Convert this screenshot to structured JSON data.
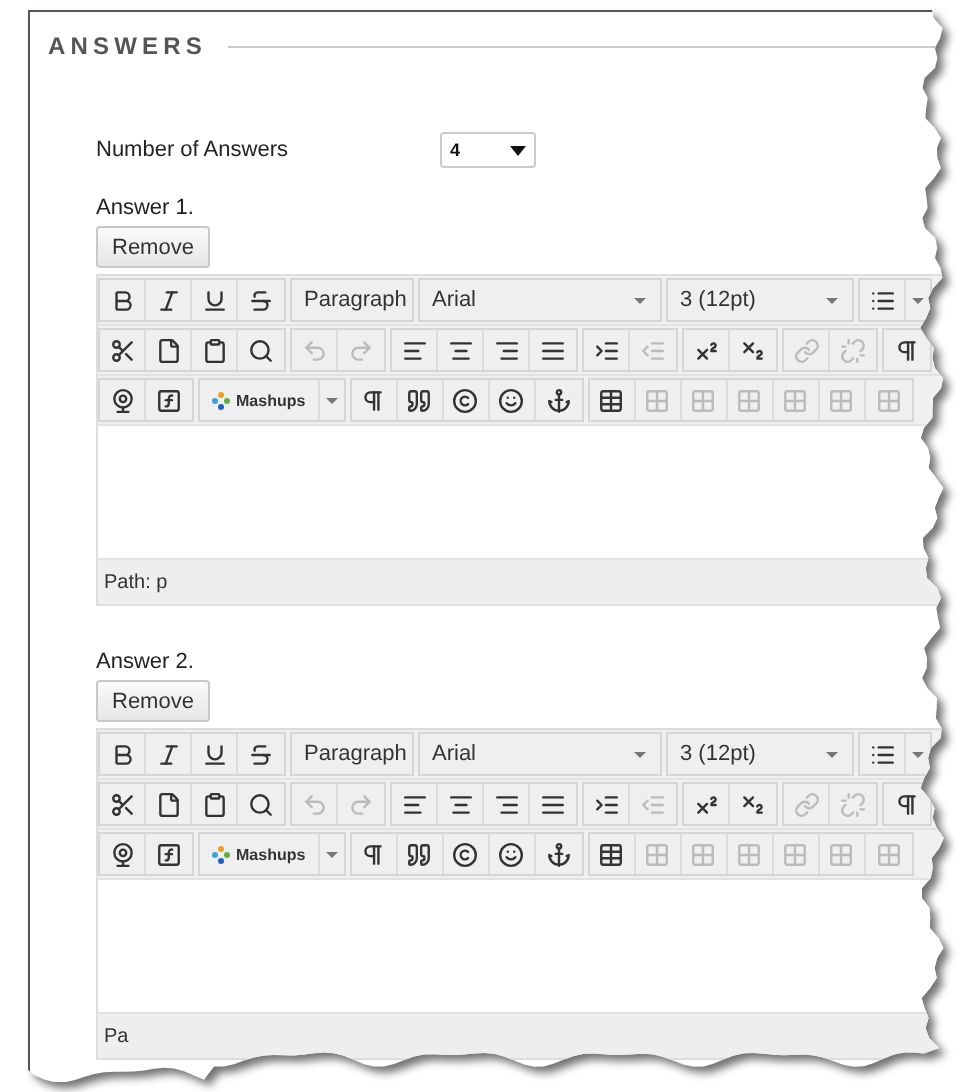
{
  "section": {
    "title": "ANSWERS"
  },
  "number_of_answers": {
    "label": "Number of Answers",
    "value": "4"
  },
  "answers": [
    {
      "label": "Answer 1.",
      "remove_button": "Remove",
      "editor": {
        "dropdowns": [
          "Paragraph",
          "Arial",
          "3 (12pt)"
        ],
        "mashups": "Mashups",
        "path": "Path: p",
        "buttons": [
          {
            "disabled": false
          },
          {
            "disabled": false
          },
          {
            "disabled": false
          },
          {
            "disabled": false
          },
          {
            "disabled": false
          },
          {
            "disabled": false
          },
          {
            "disabled": false
          },
          {
            "disabled": false
          },
          {
            "disabled": false
          },
          {
            "disabled": true
          },
          {
            "disabled": true
          },
          {
            "disabled": false
          },
          {
            "disabled": false
          },
          {
            "disabled": false
          },
          {
            "disabled": false
          },
          {
            "disabled": false
          },
          {
            "disabled": true
          },
          {
            "disabled": false
          },
          {
            "disabled": false
          },
          {
            "disabled": true
          },
          {
            "disabled": true
          },
          {
            "disabled": false
          },
          {
            "disabled": false
          },
          {
            "disabled": false
          },
          {
            "disabled": false
          },
          {
            "disabled": false
          },
          {
            "disabled": false
          },
          {
            "disabled": false
          },
          {
            "disabled": false
          },
          {
            "disabled": false
          },
          {
            "disabled": true
          },
          {
            "disabled": true
          },
          {
            "disabled": true
          },
          {
            "disabled": true
          },
          {
            "disabled": true
          },
          {
            "disabled": true
          }
        ]
      }
    },
    {
      "label": "Answer 2.",
      "remove_button": "Remove",
      "editor": {
        "dropdowns": [
          "Paragraph",
          "Arial",
          "3 (12pt)"
        ],
        "mashups": "Mashups",
        "path": "Pa",
        "buttons": [
          {
            "disabled": false
          },
          {
            "disabled": false
          },
          {
            "disabled": false
          },
          {
            "disabled": false
          },
          {
            "disabled": false
          },
          {
            "disabled": false
          },
          {
            "disabled": false
          },
          {
            "disabled": false
          },
          {
            "disabled": false
          },
          {
            "disabled": true
          },
          {
            "disabled": true
          },
          {
            "disabled": false
          },
          {
            "disabled": false
          },
          {
            "disabled": false
          },
          {
            "disabled": false
          },
          {
            "disabled": false
          },
          {
            "disabled": true
          },
          {
            "disabled": false
          },
          {
            "disabled": false
          },
          {
            "disabled": true
          },
          {
            "disabled": true
          },
          {
            "disabled": false
          },
          {
            "disabled": false
          },
          {
            "disabled": false
          },
          {
            "disabled": false
          },
          {
            "disabled": false
          },
          {
            "disabled": false
          },
          {
            "disabled": false
          },
          {
            "disabled": false
          },
          {
            "disabled": false
          },
          {
            "disabled": true
          },
          {
            "disabled": true
          },
          {
            "disabled": true
          },
          {
            "disabled": true
          },
          {
            "disabled": true
          },
          {
            "disabled": true
          }
        ]
      }
    }
  ]
}
